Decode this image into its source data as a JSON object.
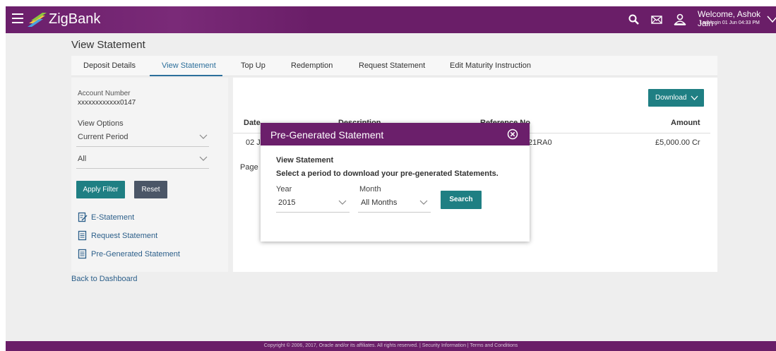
{
  "header": {
    "brand": "ZigBank",
    "welcome": "Welcome, Ashok Jain",
    "last_login": "Last login 01 Jun 04:33 PM",
    "icons": [
      "menu-icon",
      "search-icon",
      "mail-icon",
      "user-icon",
      "chevron-down-icon"
    ]
  },
  "page": {
    "title": "View Statement"
  },
  "tabs": [
    {
      "label": "Deposit Details"
    },
    {
      "label": "View Statement",
      "active": true
    },
    {
      "label": "Top Up"
    },
    {
      "label": "Redemption"
    },
    {
      "label": "Request Statement"
    },
    {
      "label": "Edit Maturity Instruction"
    }
  ],
  "left_panel": {
    "account_label": "Account Number",
    "account_value": "xxxxxxxxxxxx0147",
    "view_options_label": "View Options",
    "period_value": "Current Period",
    "type_value": "All",
    "apply_label": "Apply Filter",
    "reset_label": "Reset",
    "links": [
      {
        "label": "E-Statement",
        "icon": "e-statement-icon"
      },
      {
        "label": "Request Statement",
        "icon": "document-icon"
      },
      {
        "label": "Pre-Generated Statement",
        "icon": "document-icon"
      }
    ],
    "back_label": "Back to Dashboard"
  },
  "table": {
    "download_label": "Download",
    "columns": [
      "Date",
      "Description",
      "Reference No",
      "Amount"
    ],
    "row": {
      "date": "02 J",
      "reference": "21RA0",
      "amount": "£5,000.00 Cr"
    },
    "page_label": "Page"
  },
  "modal": {
    "title": "Pre-Generated Statement",
    "subtitle": "View Statement",
    "description": "Select a period to download your pre-generated Statements.",
    "year_label": "Year",
    "year_value": "2015",
    "month_label": "Month",
    "month_value": "All Months",
    "search_label": "Search"
  },
  "footer": {
    "text": "Copyright © 2006, 2017, Oracle and/or its affiliates. All rights reserved. | Security Information | Terms and Conditions"
  },
  "colors": {
    "brand_purple": "#6b1f6b",
    "teal": "#1f7f83",
    "slate": "#4b5667",
    "link_blue": "#2c5f8a"
  }
}
